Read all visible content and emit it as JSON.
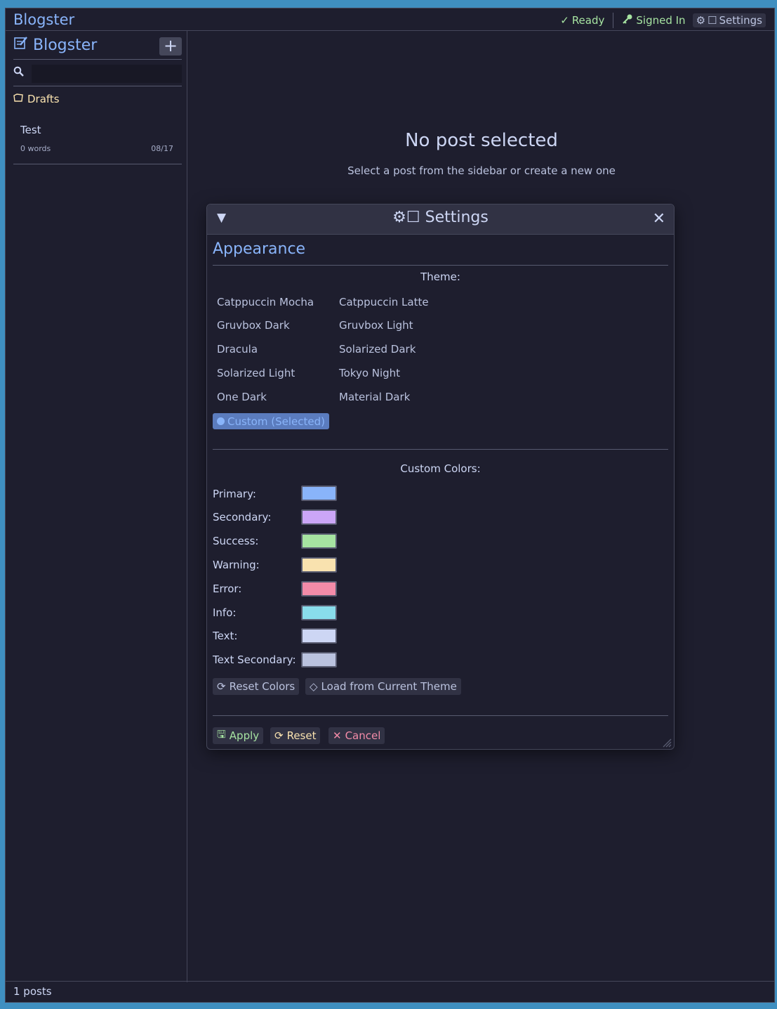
{
  "window": {
    "title": "Blogster"
  },
  "status": {
    "ready": "Ready",
    "signed_in": "Signed In",
    "settings": "Settings"
  },
  "sidebar": {
    "title": "Blogster",
    "new_button": "+",
    "search_placeholder": "",
    "section": "Drafts",
    "posts": [
      {
        "title": "Test",
        "words": "0 words",
        "date": "08/17"
      }
    ]
  },
  "main": {
    "empty_title": "No post selected",
    "empty_subtitle": "Select a post from the sidebar or create a new one"
  },
  "statusbar": {
    "post_count": "1 posts"
  },
  "settings_dialog": {
    "title": "Settings",
    "section": "Appearance",
    "theme_label": "Theme:",
    "themes": [
      "Catppuccin Mocha",
      "Catppuccin Latte",
      "Gruvbox Dark",
      "Gruvbox Light",
      "Dracula",
      "Solarized Dark",
      "Solarized Light",
      "Tokyo Night",
      "One Dark",
      "Material Dark"
    ],
    "selected_theme": "Custom (Selected)",
    "custom_colors_label": "Custom Colors:",
    "colors": [
      {
        "label": "Primary:",
        "value": "#89b4fa"
      },
      {
        "label": "Secondary:",
        "value": "#cba6f7"
      },
      {
        "label": "Success:",
        "value": "#a6e3a1"
      },
      {
        "label": "Warning:",
        "value": "#f9e2af"
      },
      {
        "label": "Error:",
        "value": "#f38ba8"
      },
      {
        "label": "Info:",
        "value": "#89dceb"
      },
      {
        "label": "Text:",
        "value": "#cdd6f4"
      },
      {
        "label": "Text Secondary:",
        "value": "#bac2de"
      }
    ],
    "reset_colors": "Reset Colors",
    "load_theme": "Load from Current Theme",
    "apply": "Apply",
    "reset": "Reset",
    "cancel": "Cancel"
  }
}
